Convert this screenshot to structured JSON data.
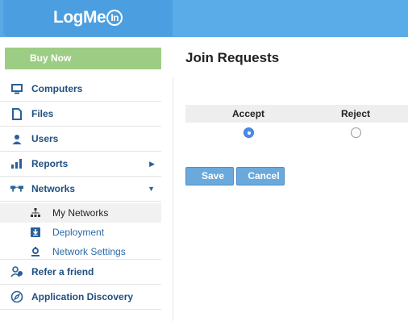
{
  "header": {
    "logo_text": "LogMe",
    "logo_badge": "In",
    "colors": {
      "header_blue": "#5aa9e6"
    }
  },
  "sidebar": {
    "buy_now_label": "Buy Now",
    "items": [
      {
        "label": "Computers",
        "icon": "monitor-icon"
      },
      {
        "label": "Files",
        "icon": "file-icon"
      },
      {
        "label": "Users",
        "icon": "user-icon"
      },
      {
        "label": "Reports",
        "icon": "bar-chart-icon",
        "chevron": "right"
      },
      {
        "label": "Networks",
        "icon": "network-icon",
        "chevron": "down"
      },
      {
        "label": "Refer a friend",
        "icon": "refer-friend-icon"
      },
      {
        "label": "Application Discovery",
        "icon": "compass-icon"
      }
    ],
    "networks_sub": [
      {
        "label": "My Networks",
        "icon": "network-tree-icon",
        "active": true
      },
      {
        "label": "Deployment",
        "icon": "download-icon"
      },
      {
        "label": "Network Settings",
        "icon": "gear-icon"
      }
    ]
  },
  "main": {
    "title": "Join Requests",
    "columns": [
      "Accept",
      "Reject"
    ],
    "selected": "Accept",
    "save_label": "Save",
    "cancel_label": "Cancel"
  }
}
